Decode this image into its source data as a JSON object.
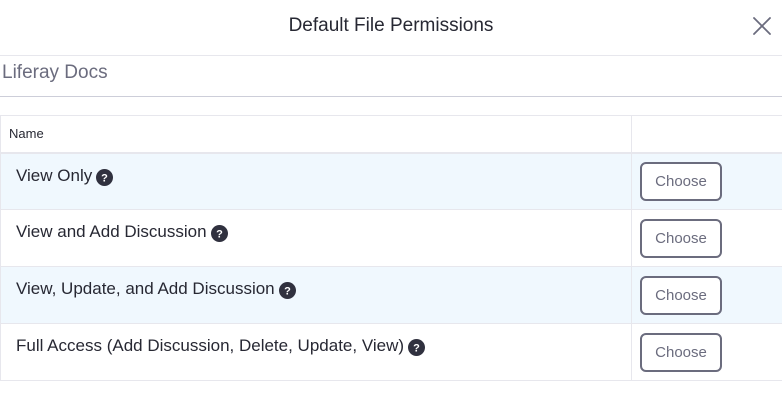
{
  "dialog": {
    "title": "Default File Permissions",
    "close_icon": "close-icon"
  },
  "site": {
    "name": "Liferay Docs"
  },
  "table": {
    "columns": [
      "Name",
      ""
    ],
    "rows": [
      {
        "label": "View Only",
        "help_icon": "question-circle-icon",
        "action": "Choose"
      },
      {
        "label": "View and Add Discussion",
        "help_icon": "question-circle-icon",
        "action": "Choose"
      },
      {
        "label": "View, Update, and Add Discussion",
        "help_icon": "question-circle-icon",
        "action": "Choose"
      },
      {
        "label": "Full Access (Add Discussion, Delete, Update, View)",
        "help_icon": "question-circle-icon",
        "action": "Choose"
      }
    ]
  },
  "colors": {
    "row_highlight": "#f0f8fe",
    "border": "#e7e7ed",
    "button_border": "#6b6c7e",
    "text": "#272833",
    "muted_text": "#6b6c7e"
  }
}
